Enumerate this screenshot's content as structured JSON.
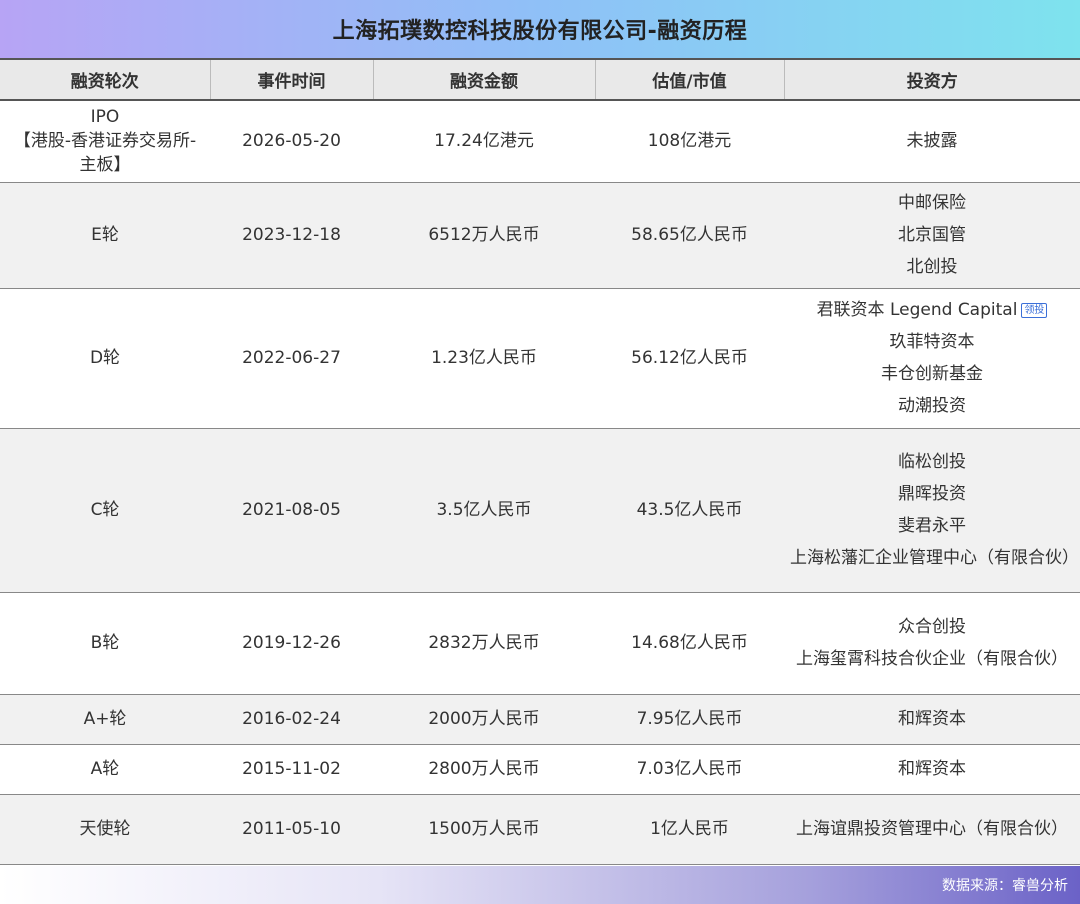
{
  "title": "上海拓璞数控科技股份有限公司-融资历程",
  "columns": [
    "融资轮次",
    "事件时间",
    "融资金额",
    "估值/市值",
    "投资方"
  ],
  "rows": [
    {
      "round": "IPO\n【港股-香港证券交易所-主板】",
      "date": "2026-05-20",
      "amount": "17.24亿港元",
      "valuation": "108亿港元",
      "investors": [
        {
          "name": "未披露"
        }
      ]
    },
    {
      "round": "E轮",
      "date": "2023-12-18",
      "amount": "6512万人民币",
      "valuation": "58.65亿人民币",
      "investors": [
        {
          "name": "中邮保险"
        },
        {
          "name": "北京国管"
        },
        {
          "name": "北创投"
        }
      ]
    },
    {
      "round": "D轮",
      "date": "2022-06-27",
      "amount": "1.23亿人民币",
      "valuation": "56.12亿人民币",
      "investors": [
        {
          "name": "君联资本 Legend Capital",
          "tag": "领投"
        },
        {
          "name": "玖菲特资本"
        },
        {
          "name": "丰仓创新基金"
        },
        {
          "name": "动潮投资"
        }
      ]
    },
    {
      "round": "C轮",
      "date": "2021-08-05",
      "amount": "3.5亿人民币",
      "valuation": "43.5亿人民币",
      "investors": [
        {
          "name": "临松创投"
        },
        {
          "name": "鼎晖投资"
        },
        {
          "name": "斐君永平"
        },
        {
          "name": "上海松藩汇企业管理中心（有限合伙）",
          "wrap": true
        }
      ]
    },
    {
      "round": "B轮",
      "date": "2019-12-26",
      "amount": "2832万人民币",
      "valuation": "14.68亿人民币",
      "investors": [
        {
          "name": "众合创投"
        },
        {
          "name": "上海玺霄科技合伙企业（有限合伙）",
          "wrap": true
        }
      ]
    },
    {
      "round": "A+轮",
      "date": "2016-02-24",
      "amount": "2000万人民币",
      "valuation": "7.95亿人民币",
      "investors": [
        {
          "name": "和辉资本"
        }
      ]
    },
    {
      "round": "A轮",
      "date": "2015-11-02",
      "amount": "2800万人民币",
      "valuation": "7.03亿人民币",
      "investors": [
        {
          "name": "和辉资本"
        }
      ]
    },
    {
      "round": "天使轮",
      "date": "2011-05-10",
      "amount": "1500万人民币",
      "valuation": "1亿人民币",
      "investors": [
        {
          "name": "上海谊鼎投资管理中心（有限合伙）",
          "wrap": true
        }
      ]
    }
  ],
  "footer": {
    "source": "数据来源：睿兽分析"
  }
}
